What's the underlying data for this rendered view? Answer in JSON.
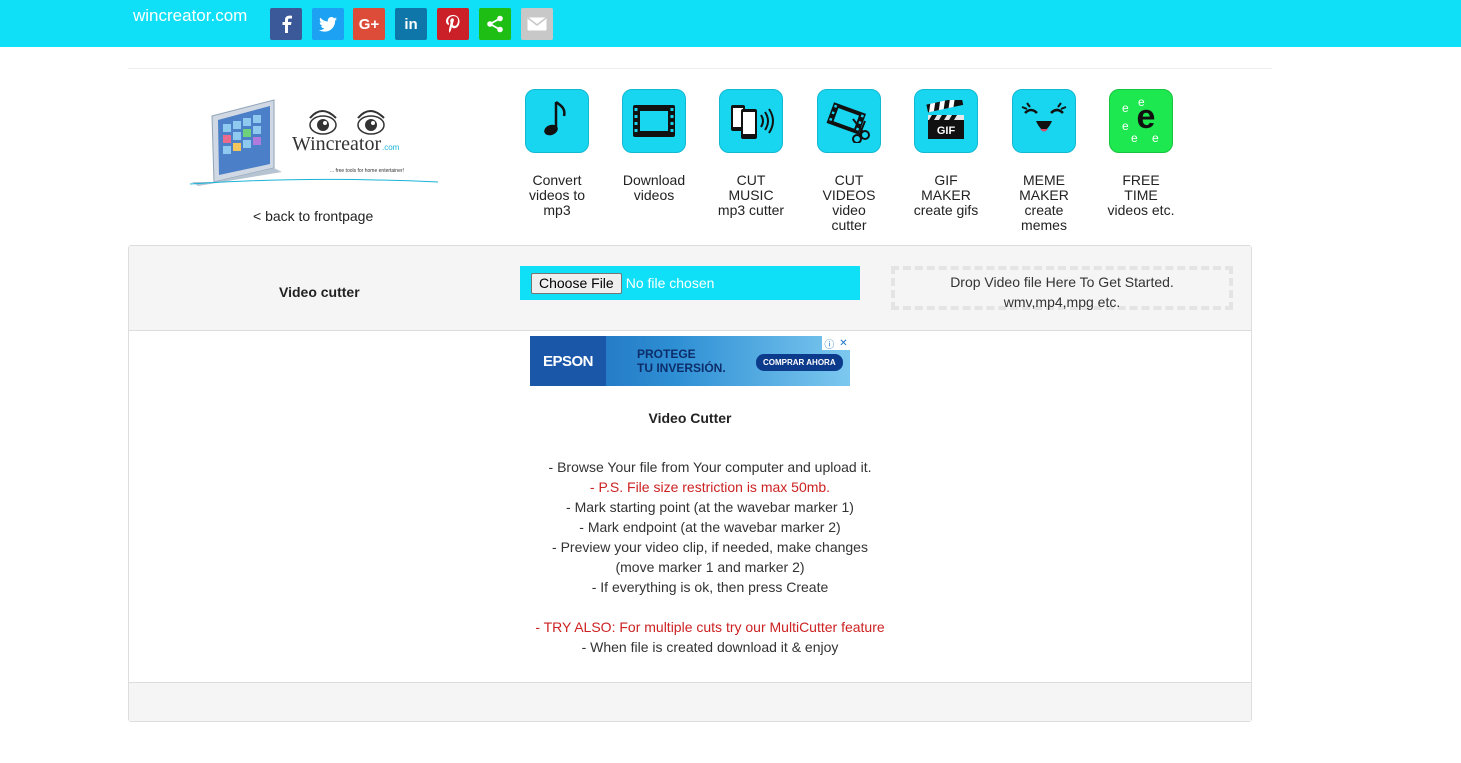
{
  "header": {
    "brand": "wincreator.com",
    "share_buttons": [
      {
        "name": "facebook",
        "color": "#3b5998",
        "glyph": "f"
      },
      {
        "name": "twitter",
        "color": "#1da1f2",
        "glyph": "t"
      },
      {
        "name": "google-plus",
        "color": "#dd4b39",
        "glyph": "G+"
      },
      {
        "name": "linkedin",
        "color": "#0e76a8",
        "glyph": "in"
      },
      {
        "name": "pinterest",
        "color": "#cb2027",
        "glyph": "P"
      },
      {
        "name": "share",
        "color": "#1fbe15",
        "glyph": "share"
      },
      {
        "name": "email",
        "color": "#c8c8c8",
        "glyph": "mail"
      }
    ]
  },
  "logo": {
    "name": "Wincreator",
    "suffix": ".com",
    "tagline": "... free tools for home entertainer!"
  },
  "back_link": "< back to frontpage",
  "tools": [
    {
      "label": "Convert\nvideos to\nmp3",
      "icon": "music-note-icon"
    },
    {
      "label": "Download\nvideos",
      "icon": "film-strip-icon"
    },
    {
      "label": "CUT\nMUSIC\nmp3 cutter",
      "icon": "phone-sound-icon"
    },
    {
      "label": "CUT\nVIDEOS\nvideo\ncutter",
      "icon": "film-scissors-icon"
    },
    {
      "label": "GIF\nMAKER\ncreate gifs",
      "icon": "gif-clapper-icon"
    },
    {
      "label": "MEME\nMAKER\ncreate\nmemes",
      "icon": "meme-face-icon"
    },
    {
      "label": "FREE\nTIME\nvideos etc.",
      "icon": "letter-e-icon"
    }
  ],
  "panel": {
    "title": "Video cutter",
    "choose_file": "Choose File",
    "no_file": "No file chosen",
    "drop_line1": "Drop Video file Here To Get Started.",
    "drop_line2": "wmv,mp4,mpg etc."
  },
  "ad": {
    "brand": "EPSON",
    "line1": "PROTEGE",
    "line2": "TU INVERSIÓN.",
    "cta": "COMPRAR AHORA"
  },
  "content": {
    "title": "Video Cutter",
    "lines": [
      "- Browse Your file from Your computer and upload it.",
      "- P.S. File size restriction is max 50mb.",
      "- Mark starting point (at the wavebar marker 1)",
      "- Mark endpoint (at the wavebar marker 2)",
      "- Preview your video clip, if needed, make changes",
      "(move marker 1 and marker 2)",
      "- If everything is ok, then press Create",
      "- TRY ALSO: For multiple cuts try our MultiCutter feature",
      "- When file is created download it & enjoy"
    ]
  },
  "colors": {
    "topbar": "#0fe0f7",
    "tile": "#19d6f0",
    "tile_green": "#1ee84f",
    "warning_text": "#cc2222"
  }
}
